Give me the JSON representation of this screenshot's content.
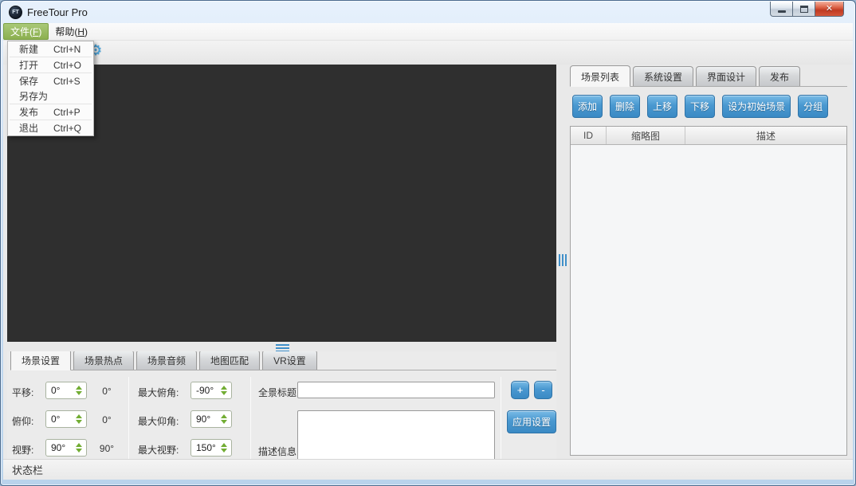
{
  "window": {
    "title": "FreeTour Pro",
    "icon_text": "FT",
    "controls": {
      "minimize": "minimize",
      "maximize": "maximize",
      "close_glyph": "✕"
    }
  },
  "menubar": {
    "file": {
      "pre": "文件(",
      "key": "F",
      "post": ")"
    },
    "help": {
      "pre": "帮助(",
      "key": "H",
      "post": ")"
    }
  },
  "toolbar": {
    "gear_glyph": "⚙"
  },
  "file_menu": {
    "items": [
      {
        "label": "新建",
        "shortcut": "Ctrl+N"
      },
      {
        "label": "打开",
        "shortcut": "Ctrl+O"
      },
      {
        "label": "保存",
        "shortcut": "Ctrl+S"
      },
      {
        "label": "另存为",
        "shortcut": ""
      },
      {
        "label": "发布",
        "shortcut": "Ctrl+P"
      },
      {
        "label": "退出",
        "shortcut": "Ctrl+Q"
      }
    ]
  },
  "right_panel": {
    "tabs": [
      "场景列表",
      "系统设置",
      "界面设计",
      "发布"
    ],
    "active_tab": "场景列表",
    "buttons": [
      "添加",
      "删除",
      "上移",
      "下移",
      "设为初始场景",
      "分组"
    ],
    "table": {
      "columns": [
        "ID",
        "缩略图",
        "描述"
      ],
      "rows": []
    }
  },
  "bottom_panel": {
    "tabs": [
      "场景设置",
      "场景热点",
      "场景音频",
      "地图匹配",
      "VR设置"
    ],
    "active_tab": "场景设置",
    "fields": {
      "pan": {
        "label": "平移:",
        "value": "0°",
        "current": "0°"
      },
      "tilt": {
        "label": "俯仰:",
        "value": "0°",
        "current": "0°"
      },
      "fov": {
        "label": "视野:",
        "value": "90°",
        "current": "90°"
      },
      "max_pitch_down": {
        "label": "最大俯角:",
        "value": "-90°"
      },
      "max_pitch_up": {
        "label": "最大仰角:",
        "value": "90°"
      },
      "max_fov": {
        "label": "最大视野:",
        "value": "150°"
      },
      "pano_title": {
        "label": "全景标题:",
        "value": ""
      },
      "description": {
        "label": "描述信息:",
        "value": ""
      }
    },
    "actions": {
      "plus": "+",
      "minus": "-",
      "apply": "应用设置"
    }
  },
  "statusbar": {
    "text": "状态栏"
  },
  "colors": {
    "accent_blue": "#3f8fc9",
    "button_blue": "#4a98d0",
    "menu_highlight_green": "#8cb050",
    "spinner_arrow_green": "#72ad33",
    "preview_background": "#2f2f2f",
    "titlebar_blue": "#cfe2f5",
    "close_button_red": "#cf4a35"
  }
}
